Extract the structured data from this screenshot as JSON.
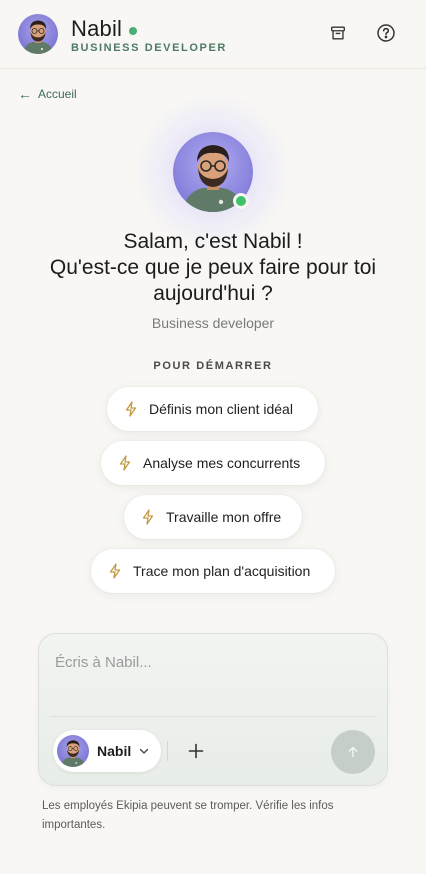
{
  "header": {
    "name": "Nabil",
    "role": "BUSINESS DEVELOPER",
    "archive_icon": "archive-icon",
    "help_icon": "help-circle-icon",
    "status_color": "#4cae75"
  },
  "nav": {
    "back_label": "Accueil",
    "back_arrow": "←"
  },
  "hero": {
    "greeting_line1": "Salam, c'est Nabil !",
    "greeting_line2": "Qu'est-ce que je peux faire pour toi aujourd'hui ?",
    "subtitle": "Business developer",
    "online_color": "#3fc26c"
  },
  "suggestions": {
    "section_label": "POUR DÉMARRER",
    "items": [
      {
        "label": "Définis mon client idéal",
        "icon": "lightning-icon"
      },
      {
        "label": "Analyse mes concurrents",
        "icon": "lightning-icon"
      },
      {
        "label": "Travaille mon offre",
        "icon": "lightning-icon"
      },
      {
        "label": "Trace mon plan d'acquisition",
        "icon": "lightning-icon"
      }
    ]
  },
  "composer": {
    "placeholder": "Écris à Nabil...",
    "value": "",
    "agent_name": "Nabil",
    "plus_icon": "plus-icon",
    "send_icon": "arrow-up-icon"
  },
  "footer": {
    "disclaimer": "Les employés Ekipia peuvent se tromper. Vérifie les infos importantes."
  },
  "colors": {
    "background": "#f8f7f4",
    "accent_green": "#4d7a66",
    "bolt": "#c49a46"
  }
}
